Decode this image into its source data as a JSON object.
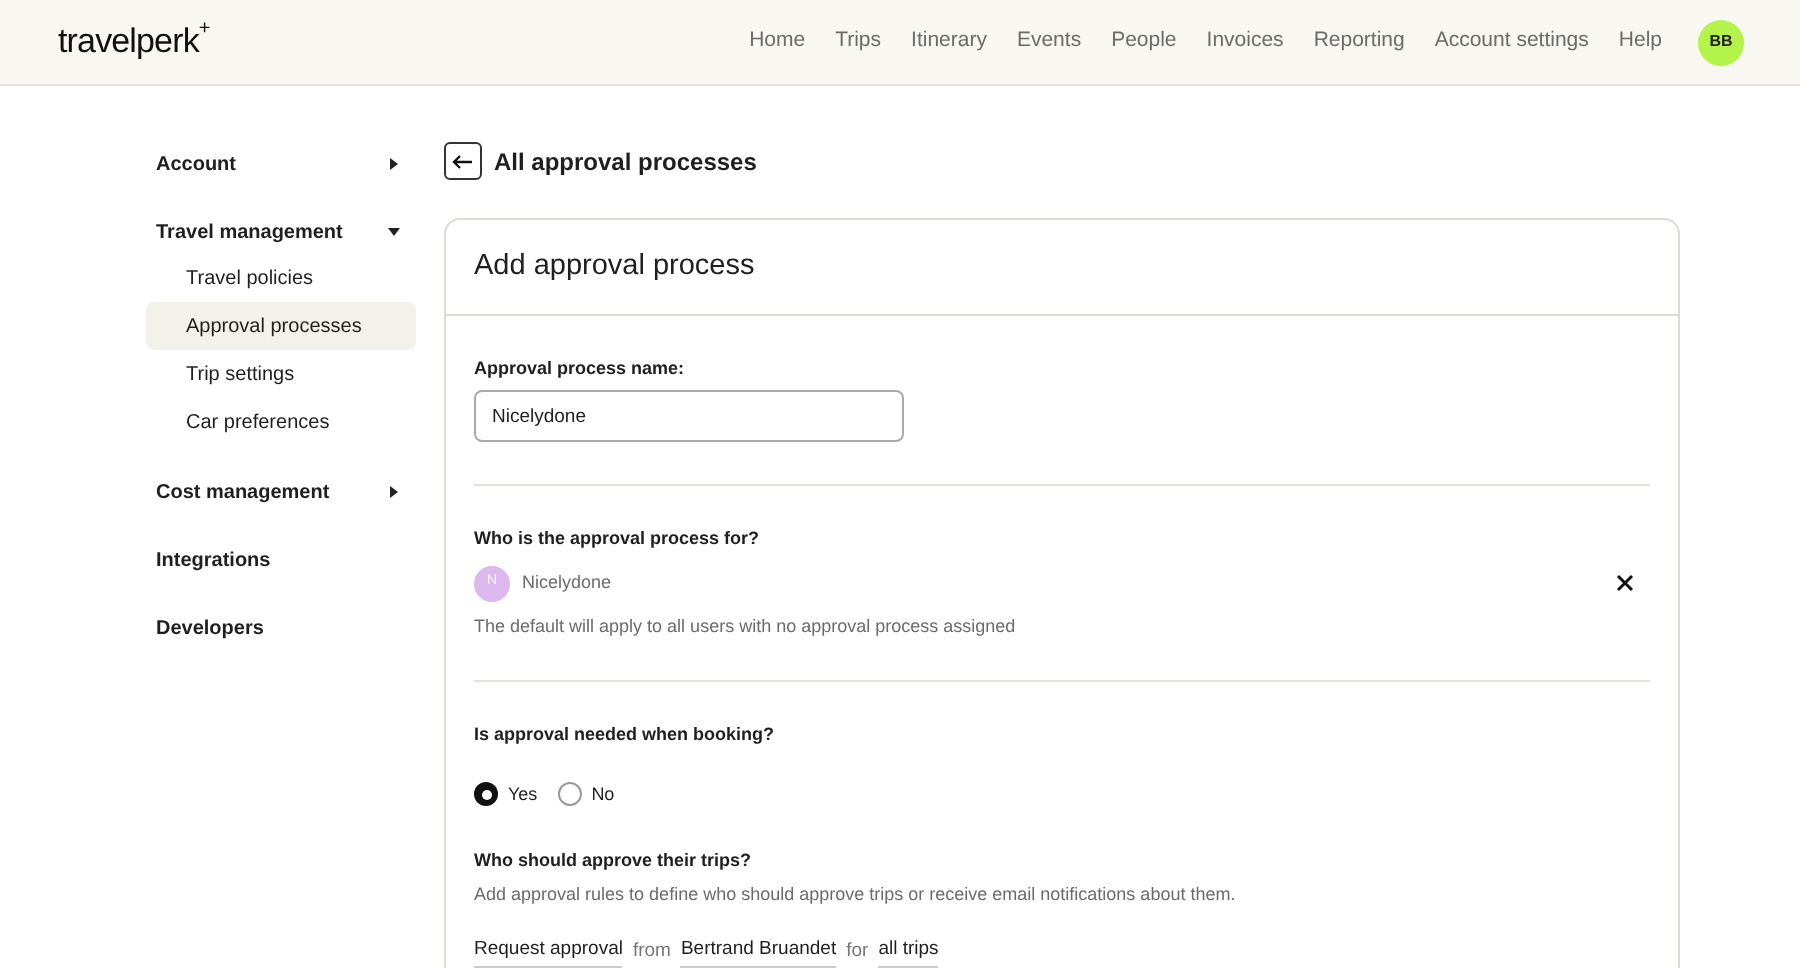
{
  "header": {
    "logo": "travelperk",
    "logo_mark": "+",
    "nav": [
      "Home",
      "Trips",
      "Itinerary",
      "Events",
      "People",
      "Invoices",
      "Reporting",
      "Account settings",
      "Help"
    ],
    "avatar": "BB"
  },
  "sidebar": {
    "items": [
      {
        "label": "Account",
        "expanded": false
      },
      {
        "label": "Travel management",
        "expanded": true,
        "children": [
          {
            "label": "Travel policies",
            "selected": false
          },
          {
            "label": "Approval processes",
            "selected": true
          },
          {
            "label": "Trip settings",
            "selected": false
          },
          {
            "label": "Car preferences",
            "selected": false
          }
        ]
      },
      {
        "label": "Cost management",
        "expanded": false
      },
      {
        "label": "Integrations"
      },
      {
        "label": "Developers"
      }
    ]
  },
  "back_link": "All approval processes",
  "card": {
    "title": "Add approval process",
    "name_field": {
      "label": "Approval process name:",
      "value": "Nicelydone"
    },
    "who_for": {
      "question": "Who is the approval process for?",
      "initial": "N",
      "name": "Nicelydone",
      "note": "The default will apply to all users with no approval process assigned"
    },
    "approval_needed": {
      "question": "Is approval needed when booking?",
      "options": [
        {
          "label": "Yes",
          "selected": true
        },
        {
          "label": "No",
          "selected": false
        }
      ]
    },
    "approvers": {
      "question": "Who should approve their trips?",
      "description": "Add approval rules to define who should approve trips or receive email notifications about them.",
      "rule": [
        {
          "kind": "select",
          "text": "Request approval"
        },
        {
          "kind": "text",
          "text": "from"
        },
        {
          "kind": "select",
          "text": "Bertrand Bruandet"
        },
        {
          "kind": "text",
          "text": "for"
        },
        {
          "kind": "select",
          "text": "all trips"
        }
      ]
    }
  }
}
